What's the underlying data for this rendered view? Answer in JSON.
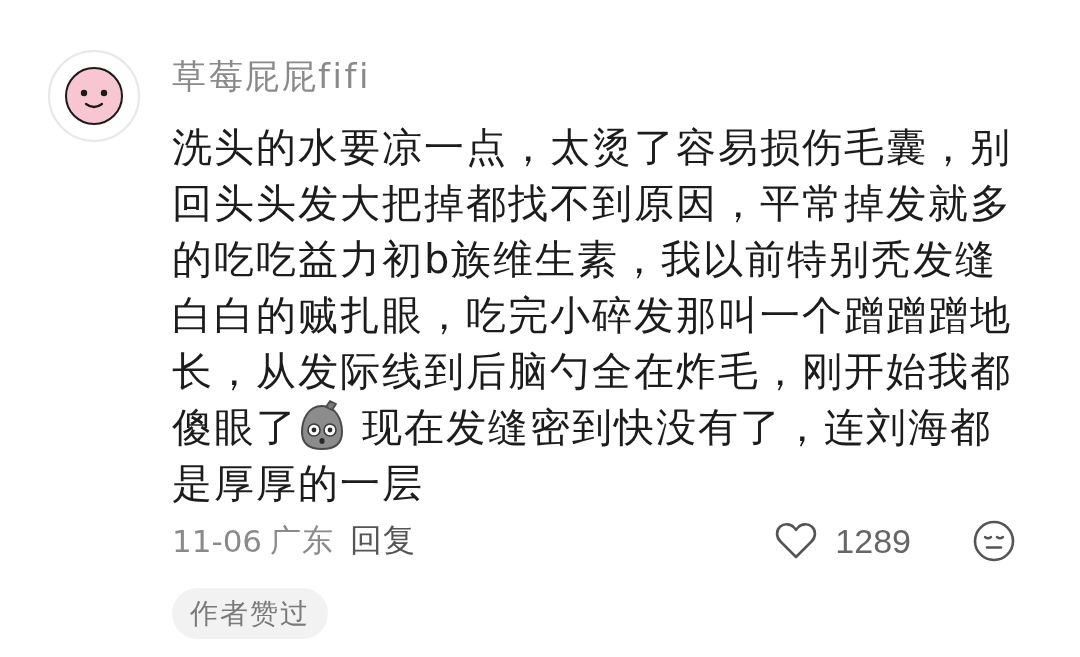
{
  "comment": {
    "author": "草莓屁屁fifi",
    "content": [
      {
        "kind": "text",
        "text": "洗头的水要凉一点，太烫了容易损伤毛囊，别回头头发大把掉都找不到原因，平常掉发就多的吃吃益力初b族维生素，我以前特别秃发缝白白的贼扎眼，吃完小碎发那叫一个蹭蹭蹭地长，从发际线到后脑勺全在炸毛，刚开始我都傻眼了"
      },
      {
        "kind": "emoji"
      },
      {
        "kind": "text",
        "text": "现在发缝密到快没有了，连刘海都是厚厚的一层"
      }
    ],
    "date": "11-06",
    "location": "广东",
    "reply": "回复",
    "likes": "1289",
    "liked": false,
    "badge": "作者赞过"
  }
}
